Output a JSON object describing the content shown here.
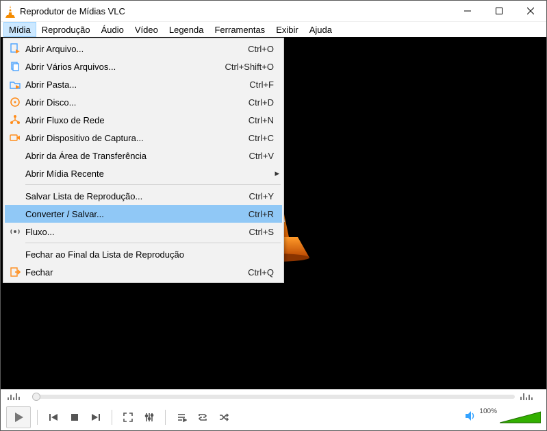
{
  "title": "Reprodutor de Mídias VLC",
  "menubar": [
    "Mídia",
    "Reprodução",
    "Áudio",
    "Vídeo",
    "Legenda",
    "Ferramentas",
    "Exibir",
    "Ajuda"
  ],
  "menubar_active_index": 0,
  "dropdown": {
    "items": [
      {
        "icon": "file-play-icon",
        "label": "Abrir Arquivo...",
        "shortcut": "Ctrl+O"
      },
      {
        "icon": "files-icon",
        "label": "Abrir Vários Arquivos...",
        "shortcut": "Ctrl+Shift+O"
      },
      {
        "icon": "folder-play-icon",
        "label": "Abrir Pasta...",
        "shortcut": "Ctrl+F"
      },
      {
        "icon": "disc-icon",
        "label": "Abrir Disco...",
        "shortcut": "Ctrl+D"
      },
      {
        "icon": "network-icon",
        "label": "Abrir Fluxo de Rede",
        "shortcut": "Ctrl+N"
      },
      {
        "icon": "capture-icon",
        "label": "Abrir Dispositivo de Captura...",
        "shortcut": "Ctrl+C"
      },
      {
        "icon": null,
        "label": "Abrir da Área de Transferência",
        "shortcut": "Ctrl+V"
      },
      {
        "icon": null,
        "label": "Abrir Mídia Recente",
        "submenu": true
      },
      {
        "separator": true
      },
      {
        "icon": null,
        "label": "Salvar Lista de Reprodução...",
        "shortcut": "Ctrl+Y"
      },
      {
        "icon": null,
        "label": "Converter / Salvar...",
        "shortcut": "Ctrl+R",
        "highlight": true
      },
      {
        "icon": "stream-icon",
        "label": "Fluxo...",
        "shortcut": "Ctrl+S"
      },
      {
        "separator": true
      },
      {
        "icon": null,
        "label": "Fechar ao Final da Lista de Reprodução"
      },
      {
        "icon": "quit-icon",
        "label": "Fechar",
        "shortcut": "Ctrl+Q"
      }
    ]
  },
  "volume_label": "100%"
}
